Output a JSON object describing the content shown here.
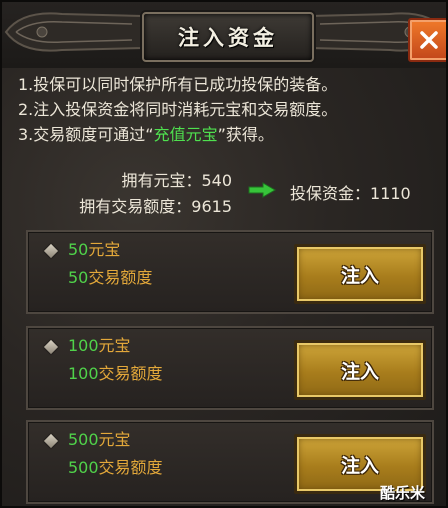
{
  "window": {
    "title": "注入资金",
    "close_icon": "close-icon"
  },
  "info": {
    "line1": "1.投保可以同时保护所有已成功投保的装备。",
    "line2": "2.注入投保资金将同时消耗元宝和交易额度。",
    "line3_prefix": "3.交易额度可通过“",
    "line3_highlight": "充值元宝",
    "line3_suffix": "”获得。"
  },
  "stats": {
    "yuanbao_label": "拥有元宝：",
    "yuanbao_value": "540",
    "trade_label": "拥有交易额度：",
    "trade_value": "9615",
    "insured_label": "投保资金：",
    "insured_value": "1110"
  },
  "options": [
    {
      "amount": "50",
      "unit": "元宝",
      "limit": "50",
      "limit_unit": "交易额度",
      "button": "注入"
    },
    {
      "amount": "100",
      "unit": "元宝",
      "limit": "100",
      "limit_unit": "交易额度",
      "button": "注入"
    },
    {
      "amount": "500",
      "unit": "元宝",
      "limit": "500",
      "limit_unit": "交易额度",
      "button": "注入"
    }
  ],
  "watermark": "酷乐米",
  "colors": {
    "highlight_green": "#4fe04f",
    "number_green": "#50d24a",
    "unit_gold": "#e3a83a",
    "close_orange": "#e06a24",
    "button_gold": "#b88a24"
  }
}
